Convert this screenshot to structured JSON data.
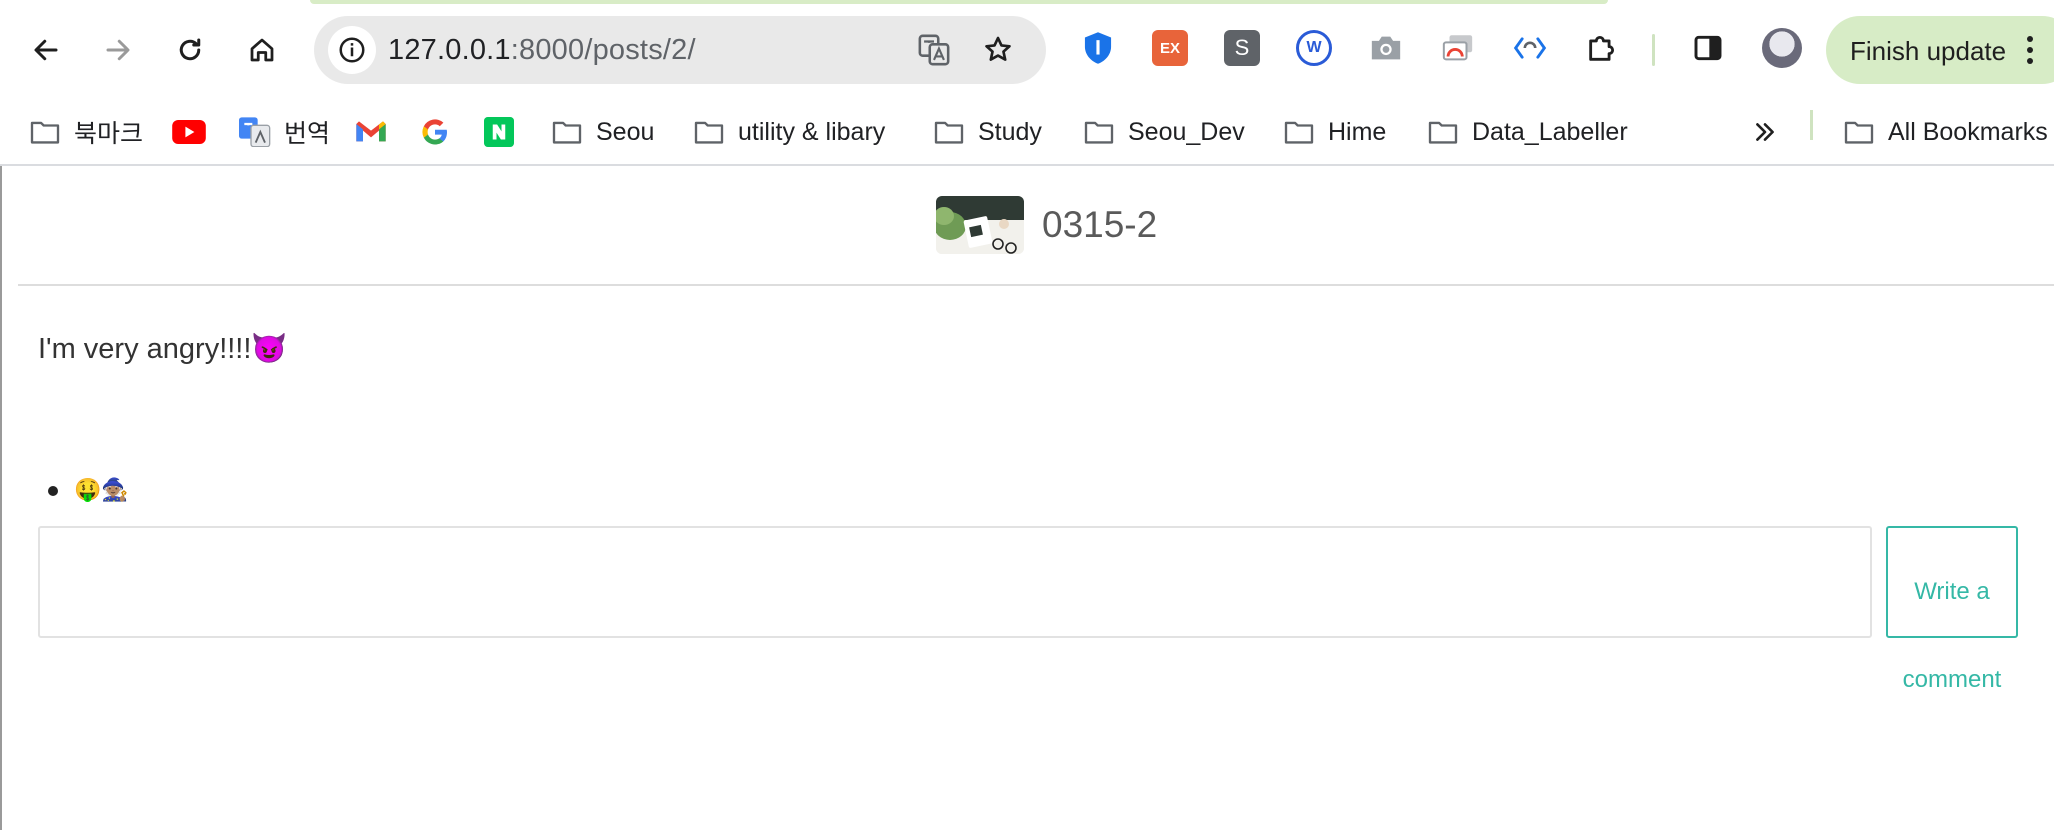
{
  "browser": {
    "url_host": "127.0.0.1",
    "url_path": ":8000/posts/2/",
    "finish_update_label": "Finish update",
    "extension_labels": {
      "ext2": "EX",
      "ext3": "S",
      "ext4": "W"
    }
  },
  "bookmarks": {
    "items": [
      {
        "label": "북마크",
        "icon": "folder-icon"
      },
      {
        "label": "",
        "icon": "youtube-icon"
      },
      {
        "label": "번역",
        "icon": "google-translate-icon"
      },
      {
        "label": "",
        "icon": "gmail-icon"
      },
      {
        "label": "",
        "icon": "google-icon"
      },
      {
        "label": "",
        "icon": "naver-icon"
      },
      {
        "label": "Seou",
        "icon": "folder-icon"
      },
      {
        "label": "utility & libary",
        "icon": "folder-icon"
      },
      {
        "label": "Study",
        "icon": "folder-icon"
      },
      {
        "label": "Seou_Dev",
        "icon": "folder-icon"
      },
      {
        "label": "Hime",
        "icon": "folder-icon"
      },
      {
        "label": "Data_Labeller",
        "icon": "folder-icon"
      }
    ],
    "all_bookmarks_label": "All Bookmarks"
  },
  "post": {
    "title": "0315-2",
    "body": "I'm very angry!!!!😈",
    "comments": [
      "🤑🧙🏽"
    ]
  },
  "comment_form": {
    "input_value": "",
    "submit_label_line1": "Write a",
    "submit_label_line2": "comment"
  },
  "colors": {
    "accent": "#35b8a6",
    "finish_update_bg": "#d7ecc6"
  }
}
